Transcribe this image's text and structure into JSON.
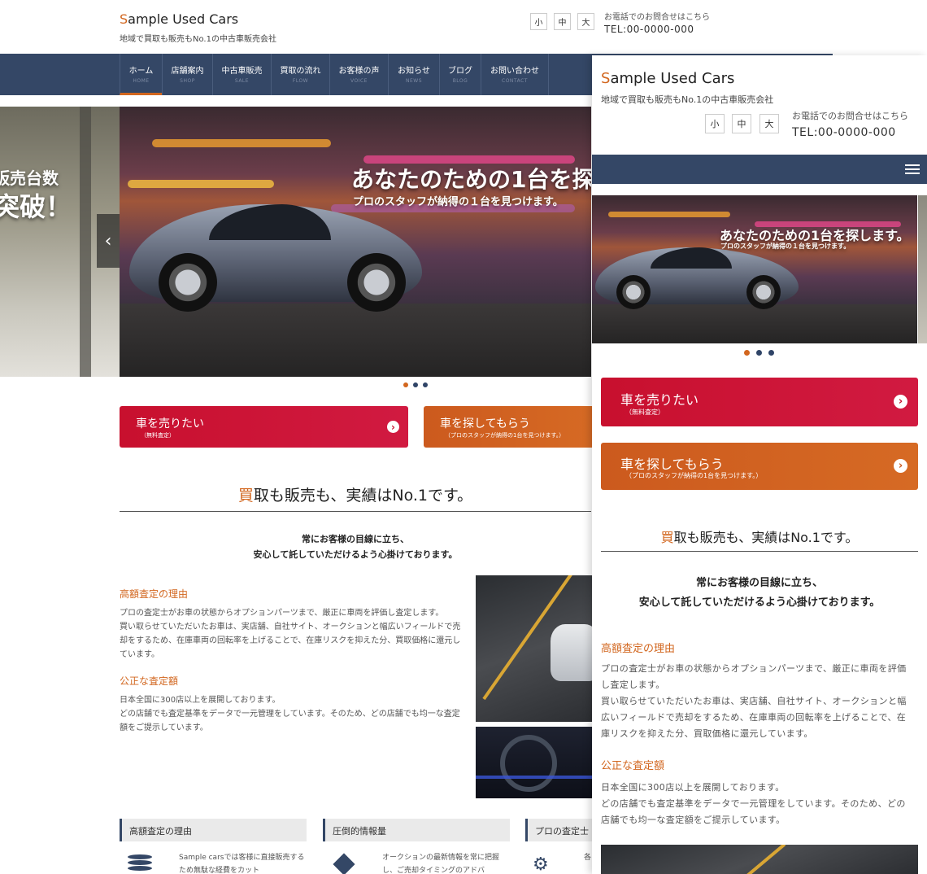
{
  "site": {
    "logo_first": "S",
    "logo_rest": "ample Used Cars",
    "tagline": "地域で買取も販売もNo.1の中古車販売会社",
    "font_sizes": [
      "小",
      "中",
      "大"
    ],
    "tel_note": "お電話でのお問合せはこちら",
    "tel": "TEL:00-0000-000"
  },
  "nav": [
    {
      "jp": "ホーム",
      "en": "HOME"
    },
    {
      "jp": "店舗案内",
      "en": "SHOP"
    },
    {
      "jp": "中古車販売",
      "en": "SALE"
    },
    {
      "jp": "買取の流れ",
      "en": "FLOW"
    },
    {
      "jp": "お客様の声",
      "en": "VOICE"
    },
    {
      "jp": "お知らせ",
      "en": "NEWS"
    },
    {
      "jp": "ブログ",
      "en": "BLOG"
    },
    {
      "jp": "お問い合わせ",
      "en": "CONTACT"
    }
  ],
  "hero": {
    "title": "あなたのための1台を探します。",
    "subtitle": "プロのスタッフが納得の１台を見つけます。",
    "prev_line1": "販売台数",
    "prev_line2": "突破！",
    "prev_arrow": "‹"
  },
  "cta": {
    "sell_title": "車を売りたい",
    "sell_sub": "（無料査定）",
    "find_title": "車を探してもらう",
    "find_sub": "（プロのスタッフが納得の1台を見つけます。）",
    "arrow": "›"
  },
  "section": {
    "title_first": "買",
    "title_rest": "取も販売も、実績はNo.1です。",
    "lead1": "常にお客様の目線に立ち、",
    "lead2": "安心して託していただけるよう心掛けております。",
    "h_reason": "高額査定の理由",
    "p_reason1": "プロの査定士がお車の状態からオプションパーツまで、厳正に車両を評価し査定します。",
    "p_reason2": "買い取らせていただいたお車は、実店舗、自社サイト、オークションと幅広いフィールドで売却をするため、在庫車両の回転率を上げることで、在庫リスクを抑えた分、買取価格に還元しています。",
    "h_fair": "公正な査定額",
    "p_fair1": "日本全国に300店以上を展開しております。",
    "p_fair2": "どの店舗でも査定基準をデータで一元管理をしています。そのため、どの店舗でも均一な査定額をご提示しています。"
  },
  "features": [
    {
      "title": "高額査定の理由",
      "text": "Sample carsでは客様に直接販売するため無駄な経費をカット"
    },
    {
      "title": "圧倒的情報量",
      "text": "オークションの最新情報を常に把握し、ご売却タイミングのアドバ"
    },
    {
      "title": "プロの査定士",
      "text": "各"
    }
  ],
  "colors": {
    "nav": "#344766",
    "accent": "#d2661e",
    "sell": "#c8102e",
    "find": "#cc5a1e"
  }
}
